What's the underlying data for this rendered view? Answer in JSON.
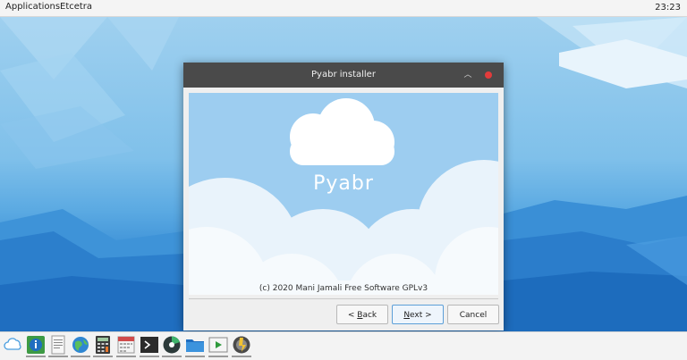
{
  "top_panel": {
    "menu_items": [
      "Applications",
      "Etcetra"
    ],
    "clock": "23:23"
  },
  "window": {
    "title": "Pyabr installer",
    "banner": {
      "app_name": "Pyabr",
      "copyright": "(c) 2020 Mani Jamali Free Software GPLv3"
    },
    "buttons": {
      "back": {
        "prefix": "< ",
        "mnemonic": "B",
        "rest": "ack"
      },
      "next": {
        "mnemonic": "N",
        "rest": "ext >"
      },
      "cancel": "Cancel"
    }
  },
  "taskbar": {
    "icons": [
      "cloud-icon",
      "info-icon",
      "text-editor-icon",
      "browser-globe-icon",
      "calculator-icon",
      "calendar-icon",
      "terminal-icon",
      "disk-usage-icon",
      "file-manager-icon",
      "media-player-icon",
      "installer-icon"
    ]
  },
  "colors": {
    "titlebar": "#4a4a4a",
    "close": "#e23b3b",
    "accent": "#5c9fd8",
    "banner_sky": "#9dcdf0"
  }
}
